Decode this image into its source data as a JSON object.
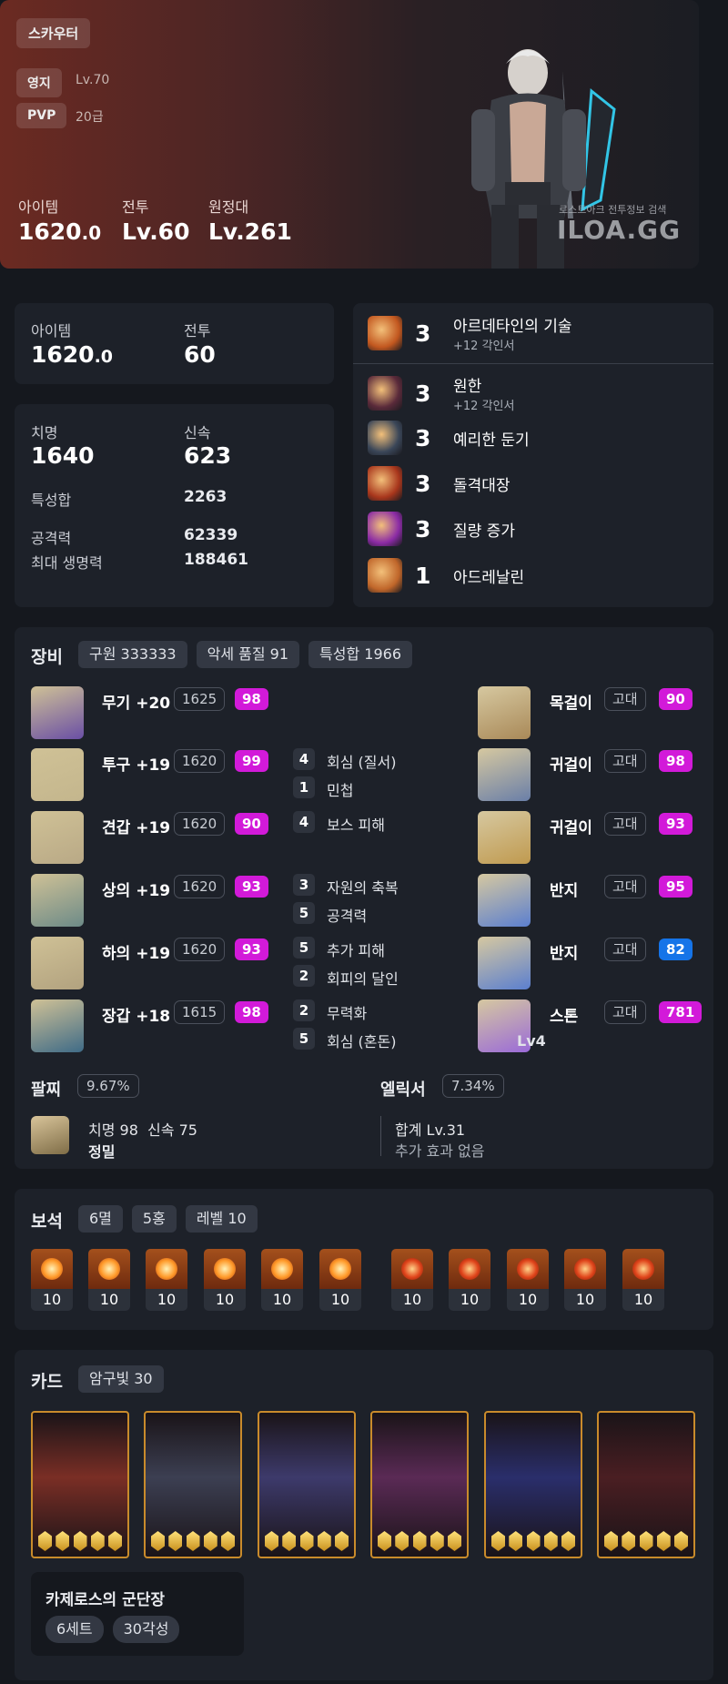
{
  "hero": {
    "class_tag": "스카우터",
    "rows": [
      {
        "tag": "영지",
        "value": "Lv.70"
      },
      {
        "tag": "PVP",
        "value": "20급"
      }
    ],
    "stats": [
      {
        "label": "아이템",
        "value": "1620",
        "decimal": ".0"
      },
      {
        "label": "전투",
        "value": "Lv.60",
        "decimal": ""
      },
      {
        "label": "원정대",
        "value": "Lv.261",
        "decimal": ""
      }
    ],
    "watermark_small": "로스트아크 전투정보 검색",
    "watermark_big": "ILOA.GG"
  },
  "summary": {
    "item_label": "아이템",
    "item_value": "1620",
    "item_decimal": ".0",
    "combat_label": "전투",
    "combat_value": "60"
  },
  "stats": {
    "crit_label": "치명",
    "crit_value": "1640",
    "swift_label": "신속",
    "swift_value": "623",
    "sum_label": "특성합",
    "sum_value": "2263",
    "atk_label": "공격력",
    "atk_value": "62339",
    "hp_label": "최대 생명력",
    "hp_value": "188461"
  },
  "engravings": [
    {
      "level": "3",
      "name": "아르데타인의 기술",
      "sub": "+12 각인서",
      "color": "#c2571f"
    },
    {
      "level": "3",
      "name": "원한",
      "sub": "+12 각인서",
      "color": "#5a2a3a"
    },
    {
      "level": "3",
      "name": "예리한 둔기",
      "sub": "",
      "color": "#3a4658"
    },
    {
      "level": "3",
      "name": "돌격대장",
      "sub": "",
      "color": "#a8361c"
    },
    {
      "level": "3",
      "name": "질량 증가",
      "sub": "",
      "color": "#8b2ba5"
    },
    {
      "level": "1",
      "name": "아드레날린",
      "sub": "",
      "color": "#c0662a"
    }
  ],
  "equipment": {
    "title": "장비",
    "pills": [
      "구원 333333",
      "악세 품질 91",
      "특성합 1966"
    ],
    "gear": [
      {
        "name": "무기 +20",
        "level": "1625",
        "quality": "98"
      },
      {
        "name": "투구 +19",
        "level": "1620",
        "quality": "99"
      },
      {
        "name": "견갑 +19",
        "level": "1620",
        "quality": "90"
      },
      {
        "name": "상의 +19",
        "level": "1620",
        "quality": "93"
      },
      {
        "name": "하의 +19",
        "level": "1620",
        "quality": "93"
      },
      {
        "name": "장갑 +18",
        "level": "1615",
        "quality": "98"
      }
    ],
    "options": [
      {
        "n": "4",
        "t": "회심 (질서)"
      },
      {
        "n": "1",
        "t": "민첩"
      },
      {
        "n": "4",
        "t": "보스 피해"
      },
      {
        "n": "3",
        "t": "자원의 축복"
      },
      {
        "n": "5",
        "t": "공격력"
      },
      {
        "n": "5",
        "t": "추가 피해"
      },
      {
        "n": "2",
        "t": "회피의 달인"
      },
      {
        "n": "2",
        "t": "무력화"
      },
      {
        "n": "5",
        "t": "회심 (혼돈)"
      }
    ],
    "accessories": [
      {
        "name": "목걸이",
        "grade": "고대",
        "quality": "90"
      },
      {
        "name": "귀걸이",
        "grade": "고대",
        "quality": "98"
      },
      {
        "name": "귀걸이",
        "grade": "고대",
        "quality": "93"
      },
      {
        "name": "반지",
        "grade": "고대",
        "quality": "95"
      },
      {
        "name": "반지",
        "grade": "고대",
        "quality": "82"
      },
      {
        "name": "스톤",
        "grade": "고대",
        "quality": "781"
      }
    ],
    "stone_level": "Lv4",
    "bracelet_label": "팔찌",
    "bracelet_pct": "9.67%",
    "bracelet_stats": "치명 98  신속 75",
    "bracelet_extra": "정밀",
    "elixir_label": "엘릭서",
    "elixir_pct": "7.34%",
    "elixir_total": "합계 Lv.31",
    "elixir_extra": "추가 효과 없음"
  },
  "gems": {
    "title": "보석",
    "pills": [
      "6멸",
      "5홍",
      "레벨 10"
    ],
    "levels": [
      "10",
      "10",
      "10",
      "10",
      "10",
      "10",
      "10",
      "10",
      "10",
      "10",
      "10"
    ]
  },
  "cards": {
    "title": "카드",
    "pill": "암구빛 30",
    "set_name": "카제로스의 군단장",
    "set_pills": [
      "6세트",
      "30각성"
    ],
    "card_colors": [
      "#7a2e25",
      "#3c3f52",
      "#3d3a6b",
      "#5a2a55",
      "#2a2e6b",
      "#4a1e22"
    ]
  }
}
